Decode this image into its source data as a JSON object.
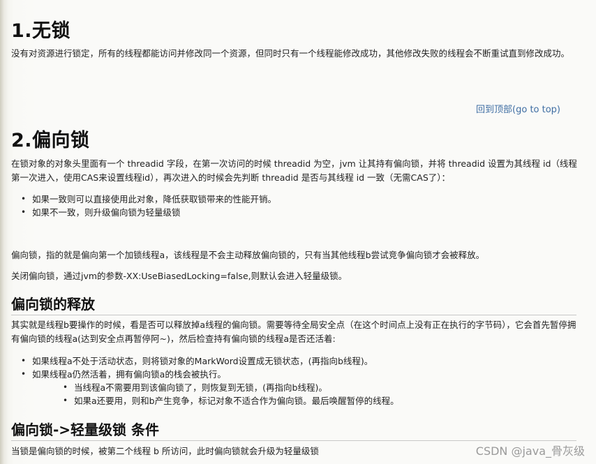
{
  "s1": {
    "title": "1.无锁",
    "p": "没有对资源进行锁定，所有的线程都能访问并修改同一个资源，但同时只有一个线程能修改成功，其他修改失败的线程会不断重试直到修改成功。"
  },
  "gotop": "回到顶部(go to top)",
  "s2": {
    "title": "2.偏向锁",
    "p": "在锁对象的对象头里面有一个 threadid 字段，在第一次访问的时候 threadid 为空，jvm 让其持有偏向锁，并将 threadid 设置为其线程 id（线程第一次进入，使用CAS来设置线程id），再次进入的时候会先判断 threadid 是否与其线程 id 一致（无需CAS了）：",
    "bullets": [
      "如果一致则可以直接使用此对象，降低获取锁带来的性能开销。",
      "如果不一致，则升级偏向锁为轻量级锁"
    ],
    "p2": "偏向锁，指的就是偏向第一个加锁线程a，该线程是不会主动释放偏向锁的，只有当其他线程b尝试竞争偏向锁才会被释放。",
    "p3": "关闭偏向锁，通过jvm的参数-XX:UseBiasedLocking=false,则默认会进入轻量级锁。"
  },
  "s3": {
    "title": "偏向锁的释放",
    "p": "其实就是线程b要操作的时候，看是否可以释放掉a线程的偏向锁。需要等待全局安全点（在这个时间点上没有正在执行的字节码），它会首先暂停拥有偏向锁的线程a(达到安全点再暂停阿~)，然后检查持有偏向锁的线程a是否还活着:",
    "bullets": [
      "如果线程a不处于活动状态，则将锁对象的MarkWord设置成无锁状态，(再指向b线程)。",
      "如果线程a仍然活着，拥有偏向锁a的栈会被执行。"
    ],
    "sub_bullets": [
      "当线程a不需要用到该偏向锁了，则恢复到无锁，(再指向b线程)。",
      "如果a还要用，则和b产生竞争，标记对象不适合作为偏向锁。最后唤醒暂停的线程。"
    ]
  },
  "s4": {
    "title": "偏向锁->轻量级锁 条件",
    "p": "当锁是偏向锁的时候，被第二个线程 b 所访问，此时偏向锁就会升级为轻量级锁"
  },
  "watermark": "CSDN @java_骨灰级"
}
